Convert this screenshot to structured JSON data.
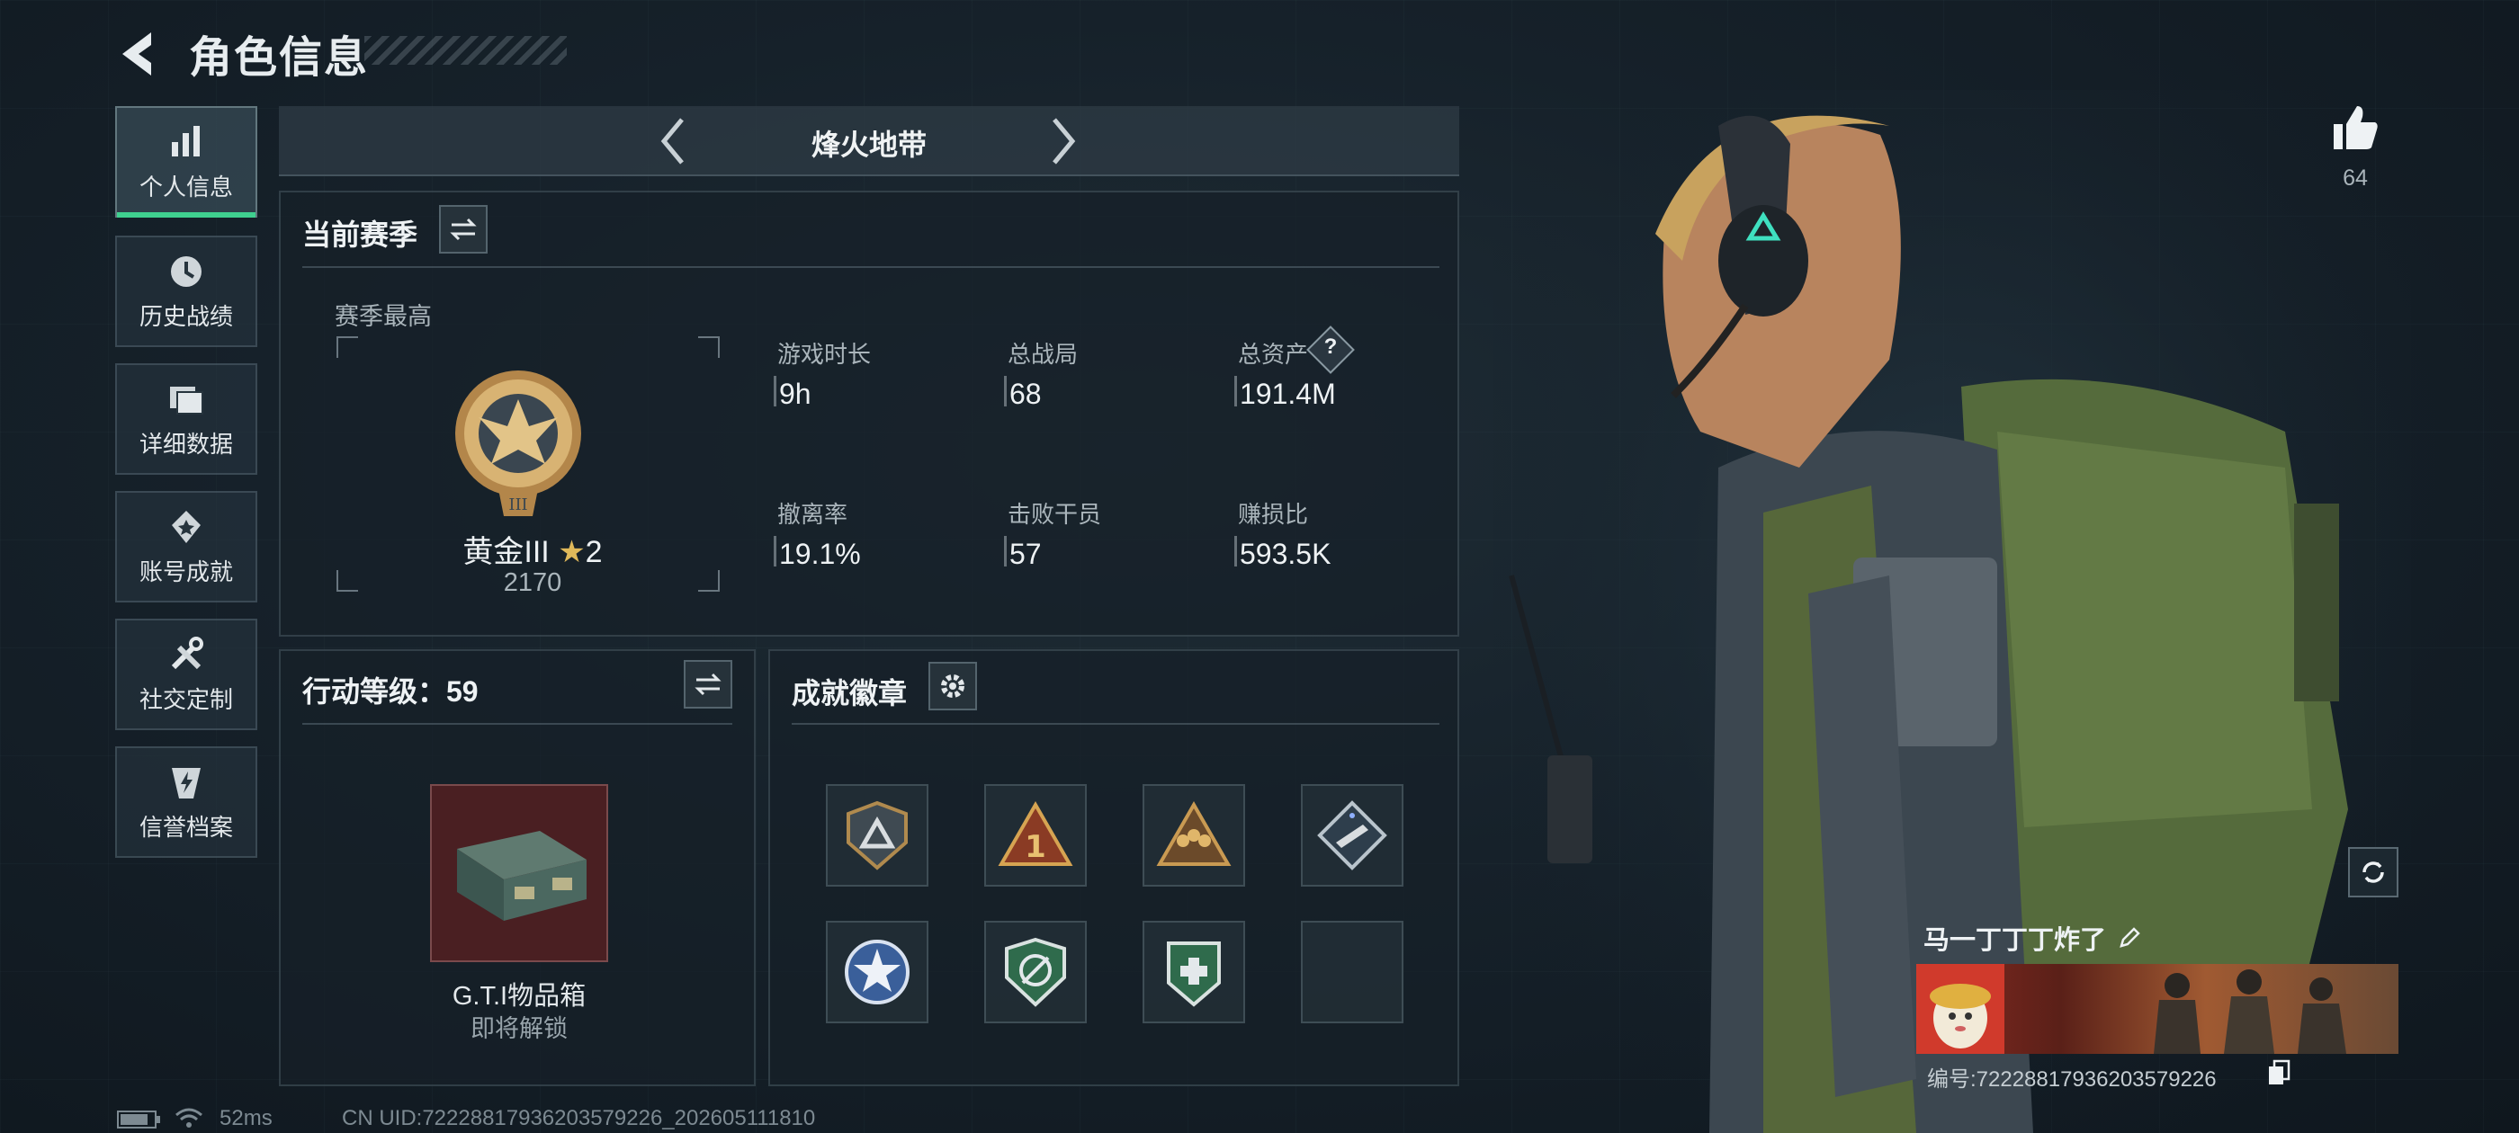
{
  "header": {
    "title": "角色信息"
  },
  "sidebar": {
    "items": [
      {
        "label": "个人信息",
        "icon": "bar-chart-icon",
        "active": true
      },
      {
        "label": "历史战绩",
        "icon": "clock-icon",
        "active": false
      },
      {
        "label": "详细数据",
        "icon": "folder-icon",
        "active": false
      },
      {
        "label": "账号成就",
        "icon": "medal-icon",
        "active": false
      },
      {
        "label": "社交定制",
        "icon": "tools-icon",
        "active": false
      },
      {
        "label": "信誉档案",
        "icon": "shield-bolt-icon",
        "active": false
      }
    ]
  },
  "mode": {
    "name": "烽火地带"
  },
  "season": {
    "title": "当前赛季",
    "best_label": "赛季最高",
    "rank_name": "黄金III",
    "rank_stars": "2",
    "rank_score": "2170",
    "stats": [
      {
        "label": "游戏时长",
        "value": "9h"
      },
      {
        "label": "总战局",
        "value": "68"
      },
      {
        "label": "总资产",
        "value": "191.4M",
        "help": "?"
      },
      {
        "label": "撤离率",
        "value": "19.1%"
      },
      {
        "label": "击败干员",
        "value": "57"
      },
      {
        "label": "赚损比",
        "value": "593.5K"
      }
    ]
  },
  "action_level": {
    "label": "行动等级：59",
    "reward_name": "G.T.I物品箱",
    "reward_status": "即将解锁"
  },
  "achievements": {
    "title": "成就徽章",
    "badges": [
      "triangle-shield-badge",
      "rank-one-badge",
      "squad-badge",
      "rocket-badge",
      "star-emblem-badge",
      "crosshair-shield-badge",
      "medic-shield-badge",
      "empty-slot"
    ]
  },
  "likes": {
    "count": "64"
  },
  "player": {
    "name": "马一丁丁丁炸了",
    "id_text": "编号:72228817936203579226"
  },
  "status_bar": {
    "ping": "52ms",
    "uid": "CN UID:72228817936203579226_202605111810"
  },
  "colors": {
    "accent_green": "#3fd08f",
    "rank_gold": "#c9a25a",
    "reward_bg": "#4a1f22"
  }
}
